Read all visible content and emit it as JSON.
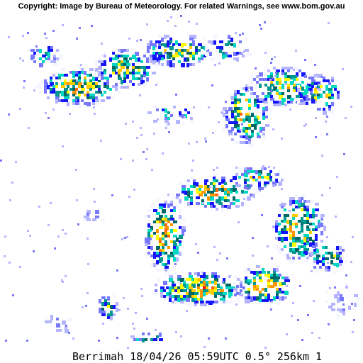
{
  "copyright_text": "Copyright: Image by Bureau of Meteorology. For related Warnings, see www.bom.gov.au",
  "caption": {
    "station": "Berrimah",
    "date": "18/04/26",
    "time": "05:59UTC",
    "elevation": "0.5°",
    "range": "256km",
    "product": "1"
  },
  "colors": {
    "background": "#ffffff",
    "reflectivity_scale": [
      "#f5f5ff",
      "#b4b4ff",
      "#7878ff",
      "#1414ff",
      "#00d8c3",
      "#009690",
      "#006666",
      "#ffff00",
      "#ffc800",
      "#ff9600",
      "#ff6400",
      "#ff0000",
      "#c80000"
    ]
  }
}
